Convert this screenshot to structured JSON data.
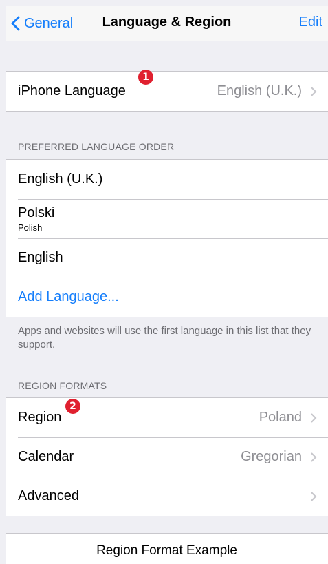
{
  "nav": {
    "back_label": "General",
    "title": "Language & Region",
    "edit_label": "Edit"
  },
  "language": {
    "label": "iPhone Language",
    "value": "English (U.K.)"
  },
  "preferred": {
    "header": "PREFERRED LANGUAGE ORDER",
    "items": [
      {
        "label": "English (U.K.)",
        "sub": ""
      },
      {
        "label": "Polski",
        "sub": "Polish"
      },
      {
        "label": "English",
        "sub": ""
      }
    ],
    "add_label": "Add Language...",
    "note": "Apps and websites will use the first language in this list that they support."
  },
  "region": {
    "header": "REGION FORMATS",
    "rows": [
      {
        "label": "Region",
        "value": "Poland"
      },
      {
        "label": "Calendar",
        "value": "Gregorian"
      },
      {
        "label": "Advanced",
        "value": ""
      }
    ]
  },
  "badges": [
    "1",
    "2"
  ],
  "example": {
    "title": "Region Format Example"
  },
  "colors": {
    "accent": "#157efb",
    "badge": "#e0202f",
    "background": "#efeff4",
    "secondary_text": "#8e8e93"
  }
}
